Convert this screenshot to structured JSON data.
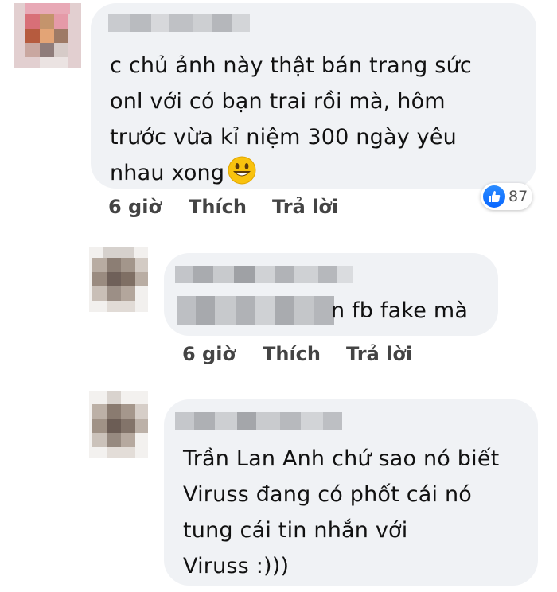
{
  "comments": [
    {
      "text_lines": [
        "c chủ ảnh này thật bán trang sức",
        "onl với có bạn trai rồi mà, hôm",
        "trước vừa kỉ niệm 300 ngày yêu",
        "nhau xong"
      ],
      "time": "6 giờ",
      "like_label": "Thích",
      "reply_label": "Trả lời",
      "reaction_count": "87"
    },
    {
      "text_visible": "n fb fake mà",
      "time": "6 giờ",
      "like_label": "Thích",
      "reply_label": "Trả lời"
    },
    {
      "text_lines": [
        "Trần Lan Anh chứ sao nó biết",
        "Viruss đang có phốt cái nó",
        "tung cái tin nhắn với",
        "Viruss :)))"
      ]
    }
  ],
  "colors": {
    "bubble": "#f0f2f5",
    "like_blue": "#0866ff"
  },
  "icons": {
    "emoji": "smiling-face-icon",
    "reaction": "like-thumb-icon"
  }
}
